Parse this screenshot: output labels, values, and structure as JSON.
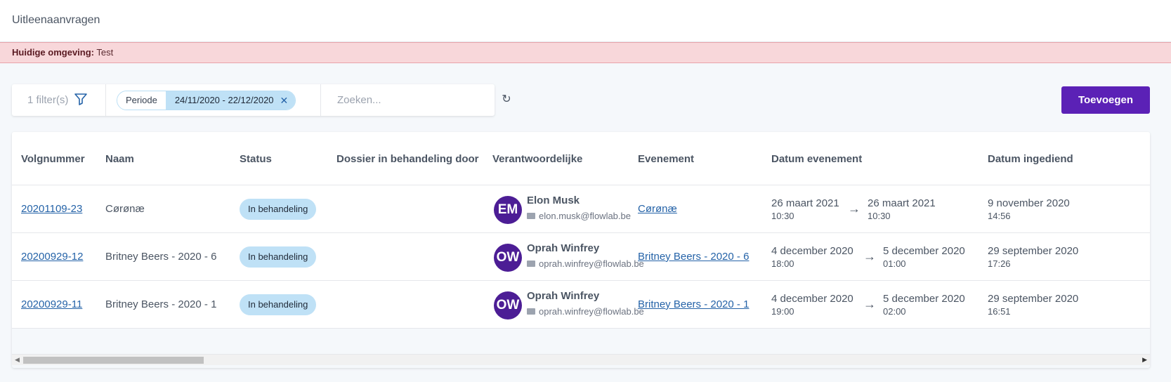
{
  "header": {
    "title": "Uitleenaanvragen"
  },
  "environment": {
    "label": "Huidige omgeving:",
    "value": "Test"
  },
  "filters": {
    "count_label": "1 filter(s)",
    "chip_key": "Periode",
    "chip_value": "24/11/2020 - 22/12/2020",
    "chip_remove": "✕",
    "search_placeholder": "Zoeken...",
    "refresh_icon": "↻"
  },
  "actions": {
    "add_label": "Toevoegen"
  },
  "table": {
    "headers": [
      "Volgnummer",
      "Naam",
      "Status",
      "Dossier in behandeling door",
      "Verantwoordelijke",
      "Evenement",
      "Datum evenement",
      "Datum ingediend"
    ],
    "rows": [
      {
        "volgnummer": "20201109-23",
        "naam": "Cørønæ",
        "status": "In behandeling",
        "dossier": "",
        "initials": "EM",
        "person": "Elon Musk",
        "email": "elon.musk@flowlab.be",
        "evenement": "Cørønæ",
        "start_date": "26 maart 2021",
        "start_time": "10:30",
        "end_date": "26 maart 2021",
        "end_time": "10:30",
        "submitted_date": "9 november 2020",
        "submitted_time": "14:56"
      },
      {
        "volgnummer": "20200929-12",
        "naam": "Britney Beers - 2020 - 6",
        "status": "In behandeling",
        "dossier": "",
        "initials": "OW",
        "person": "Oprah Winfrey",
        "email": "oprah.winfrey@flowlab.be",
        "evenement": "Britney Beers - 2020 - 6",
        "start_date": "4 december 2020",
        "start_time": "18:00",
        "end_date": "5 december 2020",
        "end_time": "01:00",
        "submitted_date": "29 september 2020",
        "submitted_time": "17:26"
      },
      {
        "volgnummer": "20200929-11",
        "naam": "Britney Beers - 2020 - 1",
        "status": "In behandeling",
        "dossier": "",
        "initials": "OW",
        "person": "Oprah Winfrey",
        "email": "oprah.winfrey@flowlab.be",
        "evenement": "Britney Beers - 2020 - 1",
        "start_date": "4 december 2020",
        "start_time": "19:00",
        "end_date": "5 december 2020",
        "end_time": "02:00",
        "submitted_date": "29 september 2020",
        "submitted_time": "16:51"
      }
    ]
  },
  "colors": {
    "accent": "#5b21b6",
    "avatar": "#4c1d95",
    "badge": "#bfe1f6",
    "env_bg": "#f8d7da",
    "link": "#2563a8"
  }
}
